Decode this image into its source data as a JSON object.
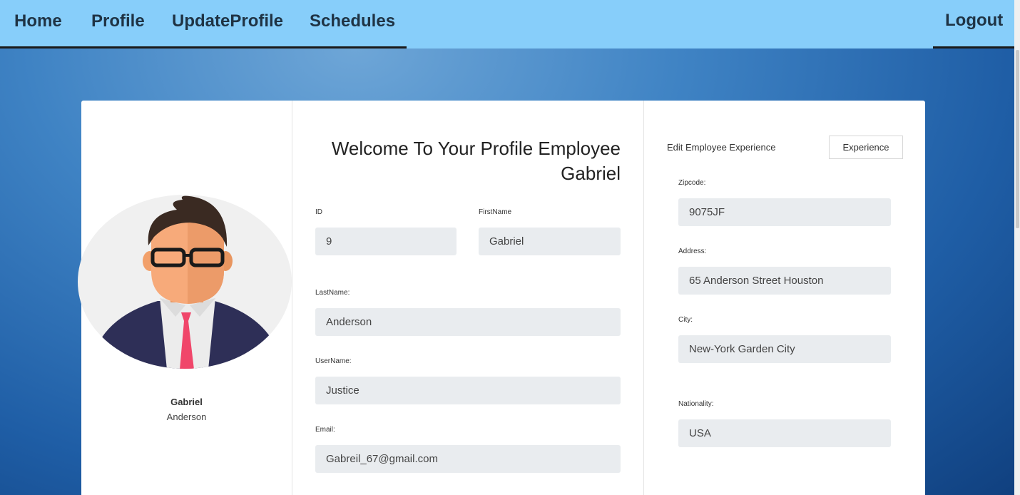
{
  "nav": {
    "home": "Home",
    "profile": "Profile",
    "update_profile": "UpdateProfile",
    "schedules": "Schedules",
    "logout": "Logout"
  },
  "profile_card": {
    "first_name": "Gabriel",
    "last_name": "Anderson"
  },
  "welcome": {
    "line1": "Welcome To Your Profile Employee",
    "line2": "Gabriel"
  },
  "form": {
    "id_label": "ID",
    "id_value": "9",
    "firstname_label": "FirstName",
    "firstname_value": "Gabriel",
    "lastname_label": "LastName:",
    "lastname_value": "Anderson",
    "username_label": "UserName:",
    "username_value": "Justice",
    "email_label": "Email:",
    "email_value": "Gabreil_67@gmail.com"
  },
  "experience": {
    "title": "Edit Employee Experience",
    "button": "Experience"
  },
  "address": {
    "zipcode_label": "Zipcode:",
    "zipcode_value": "9075JF",
    "address_label": "Address:",
    "address_value": "65 Anderson Street Houston",
    "city_label": "City:",
    "city_value": "New-York Garden City",
    "nationality_label": "Nationality:",
    "nationality_value": "USA"
  },
  "colors": {
    "navbar": "#87cefa",
    "nav_text": "#1f3344",
    "field_bg": "#e9ecef",
    "background": "#3f83c4"
  },
  "icons": {
    "avatar": "employee-avatar-icon"
  }
}
